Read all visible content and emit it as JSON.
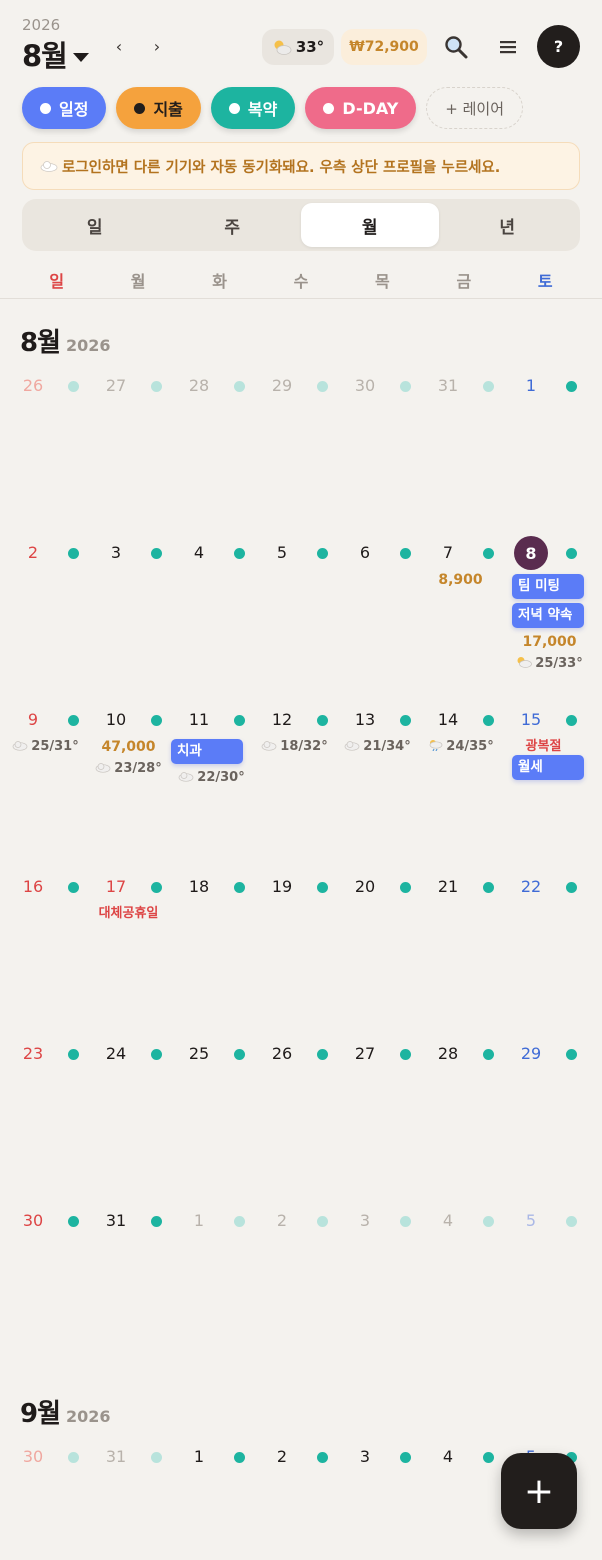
{
  "header": {
    "year": "2026",
    "month": "8월",
    "prev": "‹",
    "next": "›",
    "weather_temp": "33°",
    "weather_icon": "partly-cloudy-icon",
    "spend_total": "₩72,900",
    "help": "?"
  },
  "layers": [
    {
      "label": "일정",
      "color": "#5b7cf7"
    },
    {
      "label": "지출",
      "color": "#f5a23d"
    },
    {
      "label": "복약",
      "color": "#1db4a0"
    },
    {
      "label": "D-DAY",
      "color": "#ef6b8a"
    }
  ],
  "add_layer": "+ 레이어",
  "banner": "로그인하면 다른 기기와 자동 동기화돼요. 우측 상단 프로필을 누르세요.",
  "views": [
    "일",
    "주",
    "월",
    "년"
  ],
  "active_view": "월",
  "weekdays": [
    "일",
    "월",
    "화",
    "수",
    "목",
    "금",
    "토"
  ],
  "months": [
    {
      "title": "8월",
      "year": "2026",
      "weeks": [
        [
          {
            "d": "26",
            "muted": true
          },
          {
            "d": "27",
            "muted": true
          },
          {
            "d": "28",
            "muted": true
          },
          {
            "d": "29",
            "muted": true
          },
          {
            "d": "30",
            "muted": true
          },
          {
            "d": "31",
            "muted": true
          },
          {
            "d": "1"
          }
        ],
        [
          {
            "d": "2"
          },
          {
            "d": "3"
          },
          {
            "d": "4"
          },
          {
            "d": "5"
          },
          {
            "d": "6"
          },
          {
            "d": "7",
            "amount": "8,900"
          },
          {
            "d": "8",
            "today": true,
            "events": [
              "팀 미팅",
              "저녁 약속"
            ],
            "amount": "17,000",
            "weather": "25/33°"
          }
        ],
        [
          {
            "d": "9",
            "weather": "25/31°"
          },
          {
            "d": "10",
            "amount": "47,000",
            "weather": "23/28°"
          },
          {
            "d": "11",
            "events": [
              "치과"
            ],
            "weather": "22/30°"
          },
          {
            "d": "12",
            "weather": "18/32°"
          },
          {
            "d": "13",
            "weather": "21/34°"
          },
          {
            "d": "14",
            "weather": "24/35°",
            "weather_icon": "rain"
          },
          {
            "d": "15",
            "holiday": "광복절",
            "events": [
              "월세"
            ]
          }
        ],
        [
          {
            "d": "16"
          },
          {
            "d": "17",
            "holiday": "대체공휴일"
          },
          {
            "d": "18"
          },
          {
            "d": "19"
          },
          {
            "d": "20"
          },
          {
            "d": "21"
          },
          {
            "d": "22"
          }
        ],
        [
          {
            "d": "23"
          },
          {
            "d": "24"
          },
          {
            "d": "25"
          },
          {
            "d": "26"
          },
          {
            "d": "27"
          },
          {
            "d": "28"
          },
          {
            "d": "29"
          }
        ],
        [
          {
            "d": "30"
          },
          {
            "d": "31"
          },
          {
            "d": "1",
            "muted": true
          },
          {
            "d": "2",
            "muted": true
          },
          {
            "d": "3",
            "muted": true
          },
          {
            "d": "4",
            "muted": true
          },
          {
            "d": "5",
            "muted": true
          }
        ]
      ]
    },
    {
      "title": "9월",
      "year": "2026",
      "weeks": [
        [
          {
            "d": "30",
            "muted": true
          },
          {
            "d": "31",
            "muted": true
          },
          {
            "d": "1"
          },
          {
            "d": "2"
          },
          {
            "d": "3"
          },
          {
            "d": "4"
          },
          {
            "d": "5"
          }
        ]
      ]
    }
  ],
  "fab": "+"
}
